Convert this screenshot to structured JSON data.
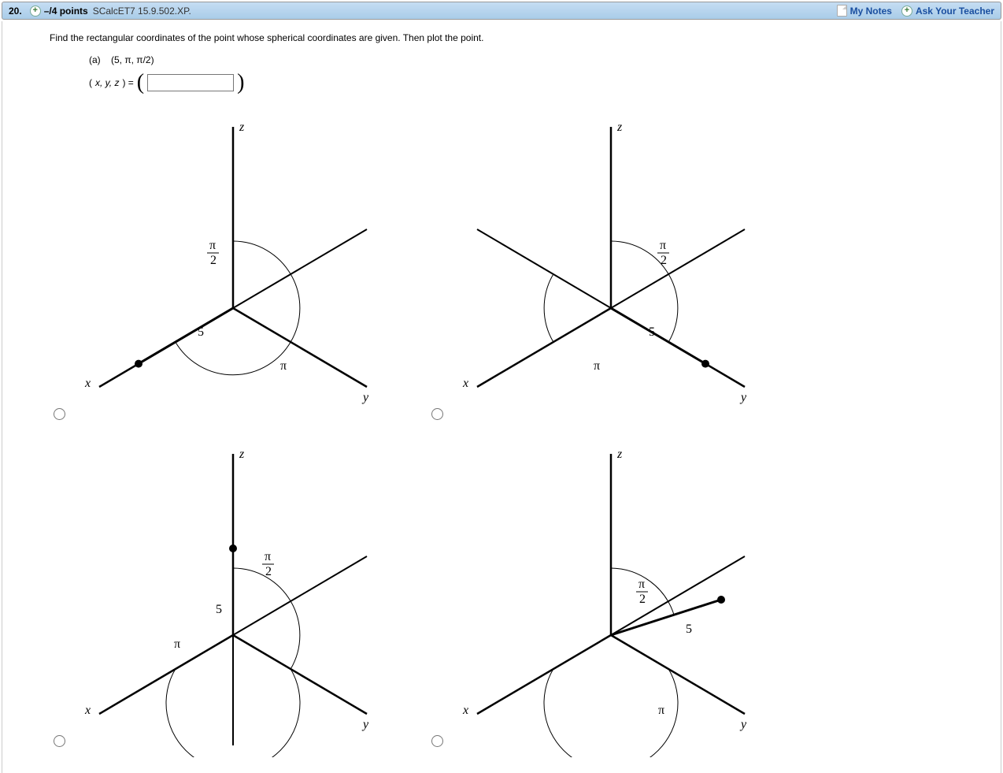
{
  "header": {
    "question_number": "20.",
    "points_text": "–/4 points",
    "source": "SCalcET7 15.9.502.XP.",
    "my_notes": "My Notes",
    "ask_teacher": "Ask Your Teacher"
  },
  "question": {
    "prompt": "Find the rectangular coordinates of the point whose spherical coordinates are given. Then plot the point.",
    "part_label": "(a)",
    "coords": "(5, π, π/2)",
    "answer_label_prefix": "(",
    "answer_label_vars": "x, y, z",
    "answer_label_suffix": ") = "
  },
  "axis": {
    "x": "x",
    "y": "y",
    "z": "z"
  },
  "labels": {
    "pi": "π",
    "pi_half_num": "π",
    "pi_half_den": "2",
    "five": "5"
  }
}
